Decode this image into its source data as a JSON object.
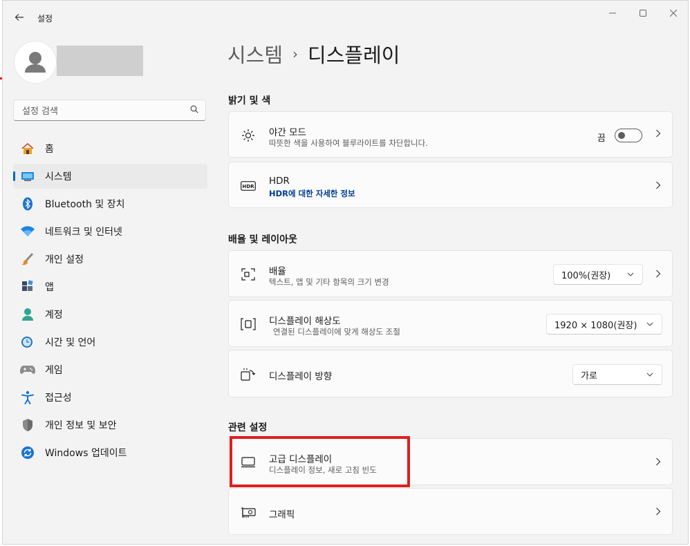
{
  "app": {
    "title": "설정"
  },
  "window_controls": {
    "minimize": "—",
    "maximize": "☐",
    "close": "✕"
  },
  "search": {
    "placeholder": "설정 검색"
  },
  "nav": {
    "items": [
      {
        "label": "홈",
        "icon": "home-icon"
      },
      {
        "label": "시스템",
        "icon": "system-icon",
        "selected": true
      },
      {
        "label": "Bluetooth 및 장치",
        "icon": "bluetooth-icon"
      },
      {
        "label": "네트워크 및 인터넷",
        "icon": "wifi-icon"
      },
      {
        "label": "개인 설정",
        "icon": "brush-icon"
      },
      {
        "label": "앱",
        "icon": "apps-icon"
      },
      {
        "label": "계정",
        "icon": "account-icon"
      },
      {
        "label": "시간 및 언어",
        "icon": "clock-globe-icon"
      },
      {
        "label": "게임",
        "icon": "gamepad-icon"
      },
      {
        "label": "접근성",
        "icon": "accessibility-icon"
      },
      {
        "label": "개인 정보 및 보안",
        "icon": "shield-icon"
      },
      {
        "label": "Windows 업데이트",
        "icon": "update-icon"
      }
    ]
  },
  "breadcrumb": {
    "parent": "시스템",
    "separator": "›",
    "current": "디스플레이"
  },
  "sections": {
    "brightness": {
      "title": "밝기 및 색"
    },
    "scale_layout": {
      "title": "배율 및 레이아웃"
    },
    "related": {
      "title": "관련 설정"
    }
  },
  "cards": {
    "night_mode": {
      "title": "야간 모드",
      "subtitle": "따뜻한 색을 사용하여 블루라이트를 차단합니다.",
      "toggle_label": "끔",
      "toggle_on": false,
      "icon": "brightness-icon"
    },
    "hdr": {
      "title": "HDR",
      "subtitle": "HDR에 대한 자세한 정보",
      "icon": "hdr-icon"
    },
    "scale": {
      "title": "배율",
      "subtitle": "텍스트, 앱 및 기타 항목의 크기 변경",
      "value": "100%(권장)",
      "icon": "scale-icon"
    },
    "resolution": {
      "title": "디스플레이 해상도",
      "subtitle": "연결된 디스플레이에 맞게 해상도 조절",
      "value": "1920 × 1080(권장)",
      "icon": "resolution-icon"
    },
    "orientation": {
      "title": "디스플레이 방향",
      "value": "가로",
      "icon": "orientation-icon"
    },
    "advanced": {
      "title": "고급 디스플레이",
      "subtitle": "디스플레이 정보, 새로 고침 빈도",
      "icon": "monitor-icon"
    },
    "graphics": {
      "title": "그래픽",
      "icon": "graphics-card-icon"
    }
  },
  "colors": {
    "accent": "#0067c0",
    "highlight": "#e01e1e",
    "link": "#003e92"
  }
}
